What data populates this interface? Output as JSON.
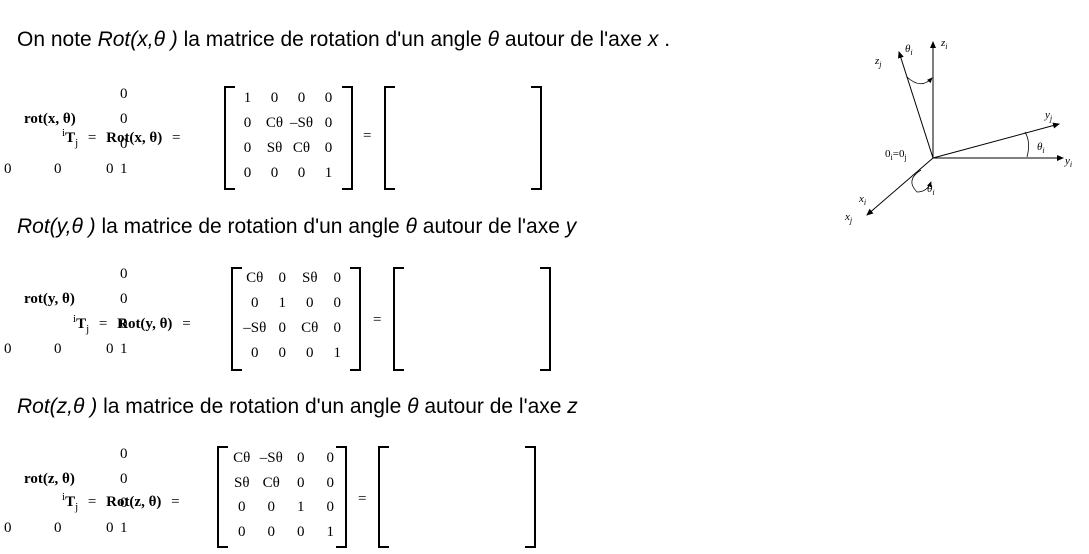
{
  "intro": {
    "prefix": "On note ",
    "rot": "Rot(x,θ )",
    "middle": " la matrice de rotation d'un angle ",
    "theta": "θ",
    "suffix": " autour de l'axe ",
    "axis": "x",
    "end": " ."
  },
  "line_y": {
    "rot": "Rot(y,θ )",
    "middle": " la matrice de rotation d'un angle ",
    "theta": "θ",
    "suffix": "  autour de l'axe ",
    "axis": "y"
  },
  "line_z": {
    "rot": "Rot(z,θ )",
    "middle": " la matrice de rotation d'un angle ",
    "theta": "θ",
    "suffix": "  autour de l'axe ",
    "axis": "z"
  },
  "equations": [
    {
      "lhs_sup": "i",
      "lhs_T": "T",
      "lhs_sub": "j",
      "equals1": "=",
      "rot_label": "Rot(x, θ)",
      "equals2": "=",
      "matrix": [
        [
          "1",
          "0",
          "0",
          "0"
        ],
        [
          "0",
          "Cθ",
          "–Sθ",
          "0"
        ],
        [
          "0",
          "Sθ",
          "Cθ",
          "0"
        ],
        [
          "0",
          "0",
          "0",
          "1"
        ]
      ],
      "block_label": "rot(x, θ)",
      "block_col": [
        "0",
        "0",
        "0"
      ],
      "block_bottom": [
        "0",
        "0",
        "0",
        "1"
      ]
    },
    {
      "lhs_sup": "i",
      "lhs_T": "T",
      "lhs_sub": "j",
      "equals1": "=",
      "rot_label": "Rot(y, θ)",
      "equals2": "=",
      "matrix": [
        [
          "Cθ",
          "0",
          "Sθ",
          "0"
        ],
        [
          "0",
          "1",
          "0",
          "0"
        ],
        [
          "–Sθ",
          "0",
          "Cθ",
          "0"
        ],
        [
          "0",
          "0",
          "0",
          "1"
        ]
      ],
      "block_label": "rot(y, θ)",
      "block_col": [
        "0",
        "0",
        "0"
      ],
      "block_bottom": [
        "0",
        "0",
        "0",
        "1"
      ]
    },
    {
      "lhs_sup": "i",
      "lhs_T": "T",
      "lhs_sub": "j",
      "equals1": "=",
      "rot_label": "Rot(z, θ)",
      "equals2": "=",
      "matrix": [
        [
          "Cθ",
          "–Sθ",
          "0",
          "0"
        ],
        [
          "Sθ",
          "Cθ",
          "0",
          "0"
        ],
        [
          "0",
          "0",
          "1",
          "0"
        ],
        [
          "0",
          "0",
          "0",
          "1"
        ]
      ],
      "block_label": "rot(z, θ)",
      "block_col": [
        "0",
        "0",
        "0"
      ],
      "block_bottom": [
        "0",
        "0",
        "0",
        "1"
      ]
    }
  ],
  "diagram": {
    "theta_top": "θ",
    "theta_top_sub": "i",
    "z_i": "z",
    "z_i_sub": "i",
    "z_j": "z",
    "z_j_sub": "j",
    "y_j": "y",
    "y_j_sub": "j",
    "y_i": "y",
    "y_i_sub": "i",
    "theta_right": "θ",
    "theta_right_sub": "i",
    "origin": "0",
    "origin_sub_i": "i",
    "origin_eq": "=",
    "origin_sub_j": "j",
    "x_i": "x",
    "x_i_sub": "i",
    "x_j": "x",
    "x_j_sub": "j",
    "theta_bottom": "θ",
    "theta_bottom_sub": "i"
  }
}
